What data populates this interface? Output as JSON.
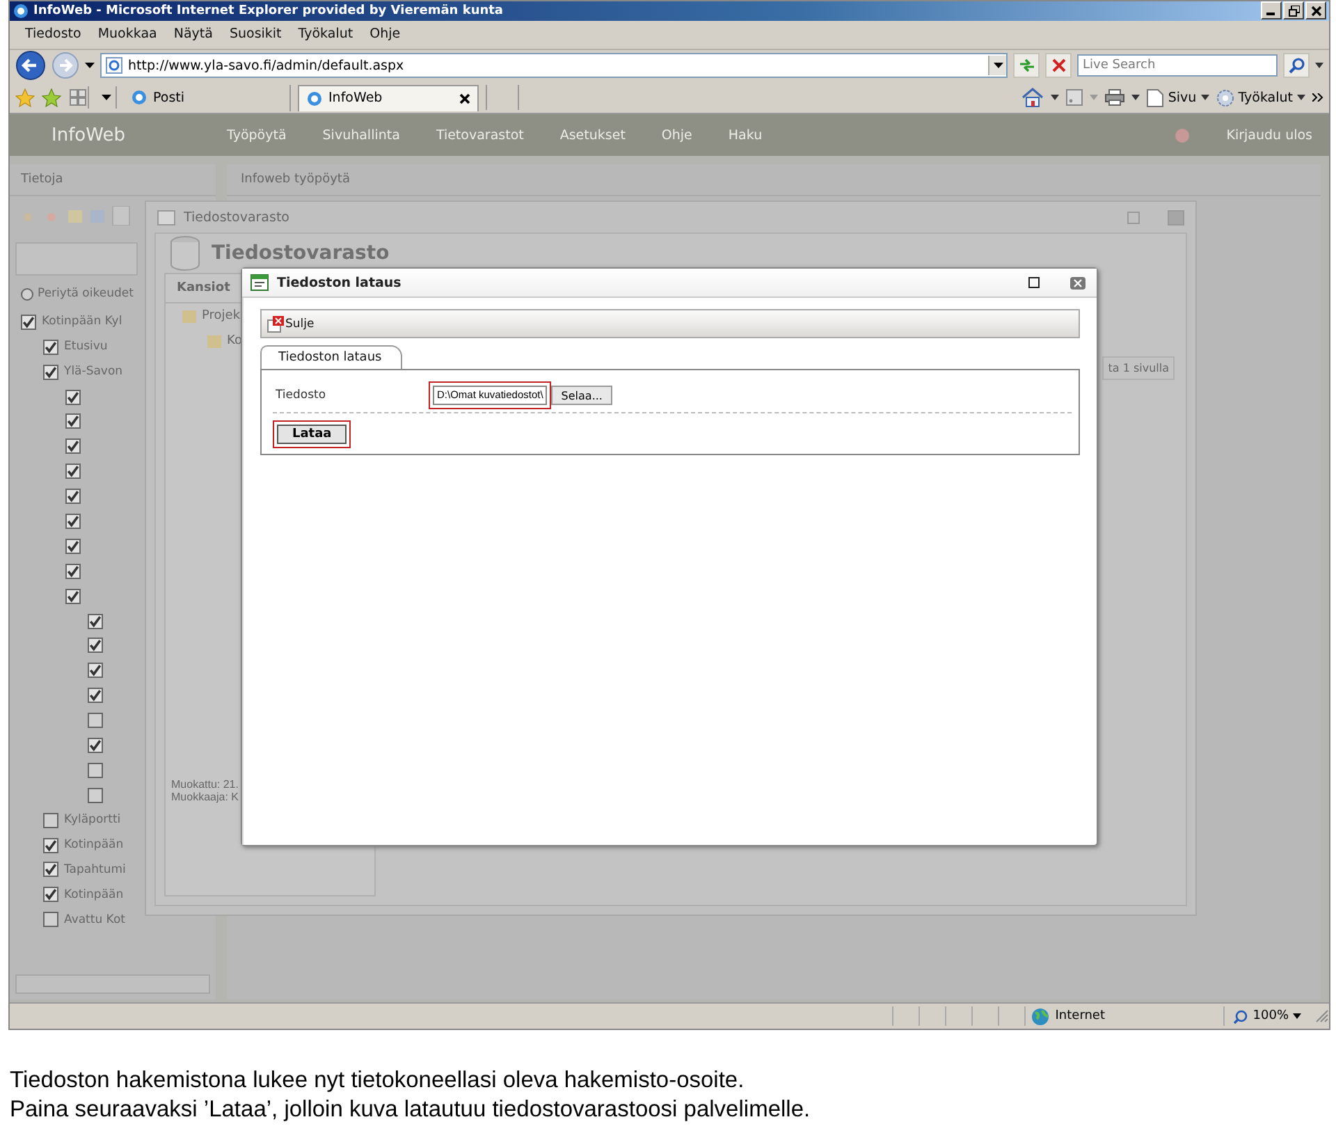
{
  "browser": {
    "title": "InfoWeb - Microsoft Internet Explorer provided by Vieremän kunta",
    "menu": [
      "Tiedosto",
      "Muokkaa",
      "Näytä",
      "Suosikit",
      "Työkalut",
      "Ohje"
    ],
    "address": "http://www.yla-savo.fi/admin/default.aspx",
    "search": {
      "placeholder": "Live Search"
    },
    "tabs": [
      {
        "label": "Posti",
        "selected": false
      },
      {
        "label": "InfoWeb",
        "selected": true
      }
    ],
    "tools": [
      "Sivu",
      "Työkalut"
    ],
    "status": {
      "zone": "Internet",
      "zoom": "100%"
    }
  },
  "app": {
    "logo": "InfoWeb",
    "nav": [
      "Työpöytä",
      "Sivuhallinta",
      "Tietovarastot",
      "Asetukset",
      "Ohje",
      "Haku"
    ],
    "logout": "Kirjaudu ulos",
    "side_title": "Tietoja",
    "main_title": "Infoweb työpöytä",
    "inherit": "Periytä oikeudet",
    "inherit_selected": false,
    "tree": [
      {
        "label": "Kotinpään Kyl",
        "checked": true,
        "children": [
          {
            "label": "Etusivu",
            "checked": true
          },
          {
            "label": "Ylä-Savon",
            "checked": true,
            "children": [
              {
                "checked": true
              },
              {
                "checked": true
              },
              {
                "checked": true
              },
              {
                "checked": true
              },
              {
                "checked": true
              },
              {
                "checked": true
              },
              {
                "checked": true
              },
              {
                "checked": true
              },
              {
                "checked": true,
                "children": [
                  {
                    "checked": true
                  },
                  {
                    "checked": true
                  },
                  {
                    "checked": true
                  },
                  {
                    "checked": true
                  },
                  {
                    "checked": false
                  },
                  {
                    "checked": true
                  },
                  {
                    "checked": false
                  },
                  {
                    "checked": false
                  }
                ]
              }
            ]
          },
          {
            "label": "Kyläportti",
            "checked": false
          },
          {
            "label": "Kotinpään",
            "checked": true
          },
          {
            "label": "Tapahtumi",
            "checked": true
          },
          {
            "label": "Kotinpään",
            "checked": true
          },
          {
            "label": "Avattu Kot",
            "checked": false
          }
        ]
      }
    ]
  },
  "store_window": {
    "title": "Tiedostovarasto",
    "heading": "Tiedostovarasto",
    "folders_title": "Kansiot",
    "folders": [
      "Projek",
      "Ko"
    ],
    "modified": "Muokattu: 21.",
    "modifier": "Muokkaaja: K",
    "pager": "ta 1 sivulla"
  },
  "dialog": {
    "title": "Tiedoston lataus",
    "close": "Sulje",
    "tab": {
      "label": "Tiedoston lataus",
      "selected": true
    },
    "field_label": "Tiedosto",
    "file_value": "D:\\Omat kuvatiedostot\\",
    "browse": "Selaa...",
    "upload": "Lataa",
    "file_highlighted": true,
    "upload_highlighted": true
  },
  "caption": [
    "Tiedoston hakemistona lukee nyt tietokoneellasi oleva hakemisto-osoite.",
    "Paina seuraavaksi ’Lataa’, jolloin kuva latautuu tiedostovarastoosi palvelimelle."
  ]
}
